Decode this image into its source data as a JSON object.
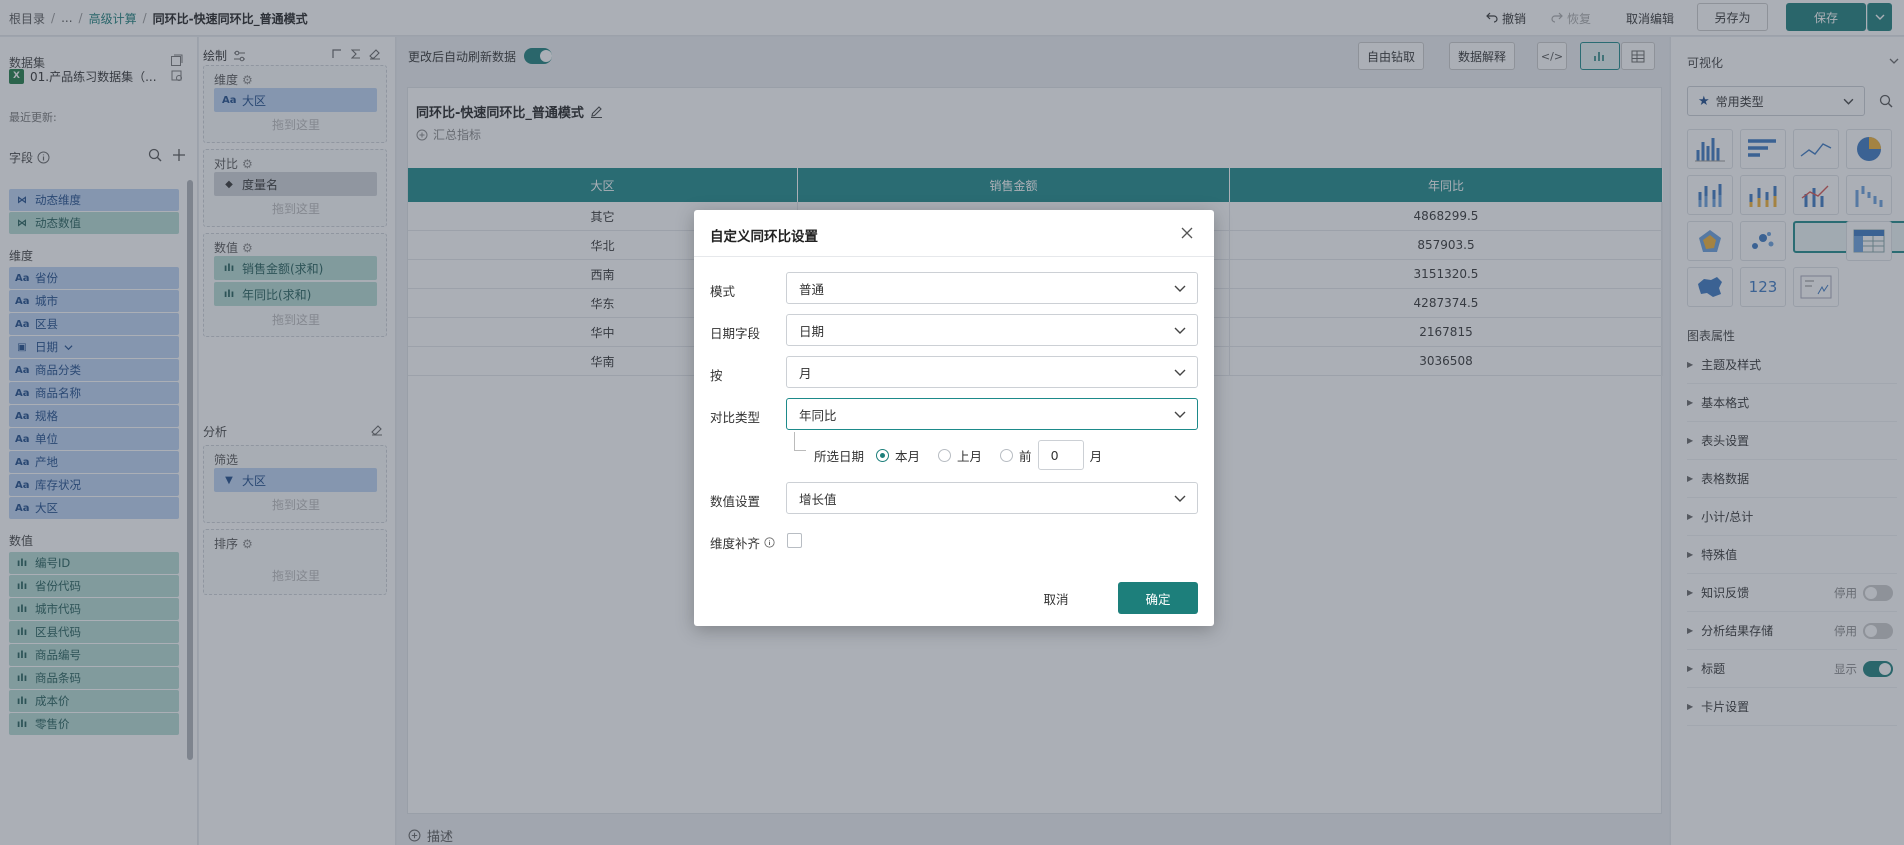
{
  "topbar": {
    "breadcrumb": [
      "根目录",
      "...",
      "高级计算",
      "同环比-快速同环比_普通模式"
    ],
    "undo": "撤销",
    "redo": "恢复",
    "cancel_edit": "取消编辑",
    "save_as": "另存为",
    "save": "保存"
  },
  "left": {
    "dataset_title": "数据集",
    "dataset_name": "01.产品练习数据集（...",
    "last_update": "最近更新:",
    "fields_title": "字段",
    "dynamic": [
      "动态维度",
      "动态数值"
    ],
    "dim_title": "维度",
    "dimensions": [
      "省份",
      "城市",
      "区县",
      "日期",
      "商品分类",
      "商品名称",
      "规格",
      "单位",
      "产地",
      "库存状况",
      "大区"
    ],
    "mea_title": "数值",
    "measures": [
      "编号ID",
      "省份代码",
      "城市代码",
      "区县代码",
      "商品编号",
      "商品条码",
      "成本价",
      "零售价"
    ]
  },
  "config": {
    "draw": "绘制",
    "dim_label": "维度",
    "dim_pill": "大区",
    "compare_label": "对比",
    "compare_pill": "度量名",
    "value_label": "数值",
    "value_pills": [
      "销售金额(求和)",
      "年同比(求和)"
    ],
    "drop_hint": "拖到这里",
    "analysis": "分析",
    "filter_label": "筛选",
    "filter_pill": "大区",
    "sort_label": "排序"
  },
  "center": {
    "auto_refresh": "更改后自动刷新数据",
    "drill": "自由钻取",
    "explain": "数据解释",
    "chart_title": "同环比-快速同环比_普通模式",
    "summary": "汇总指标",
    "describe": "描述",
    "headers": [
      "大区",
      "销售金额",
      "年同比"
    ],
    "rows": [
      [
        "其它",
        "",
        "4868299.5"
      ],
      [
        "华北",
        "",
        "857903.5"
      ],
      [
        "西南",
        "",
        "3151320.5"
      ],
      [
        "华东",
        "",
        "4287374.5"
      ],
      [
        "华中",
        "",
        "2167815"
      ],
      [
        "华南",
        "",
        "3036508"
      ]
    ]
  },
  "right": {
    "title": "可视化",
    "type_select": "常用类型",
    "chart_props": "图表属性",
    "props": [
      {
        "label": "主题及样式"
      },
      {
        "label": "基本格式"
      },
      {
        "label": "表头设置"
      },
      {
        "label": "表格数据"
      },
      {
        "label": "小计/总计"
      },
      {
        "label": "特殊值"
      },
      {
        "label": "知识反馈",
        "state": "停用"
      },
      {
        "label": "分析结果存储",
        "state": "停用"
      },
      {
        "label": "标题",
        "state": "显示"
      },
      {
        "label": "卡片设置"
      }
    ],
    "num_icon": "123"
  },
  "dialog": {
    "title": "自定义同环比设置",
    "mode_label": "模式",
    "mode_value": "普通",
    "date_label": "日期字段",
    "date_value": "日期",
    "by_label": "按",
    "by_value": "月",
    "cmp_label": "对比类型",
    "cmp_value": "年同比",
    "sel_date": "所选日期",
    "opt_this": "本月",
    "opt_last": "上月",
    "opt_prev": "前",
    "prev_value": "0",
    "unit": "月",
    "num_label": "数值设置",
    "num_value": "增长值",
    "fill_label": "维度补齐",
    "cancel": "取消",
    "ok": "确定"
  },
  "colors": {
    "primary": "#1d7f7b",
    "header": "#1d8a8a",
    "dim_field": "#bcd4f3",
    "mea_field": "#b6dcd4"
  }
}
